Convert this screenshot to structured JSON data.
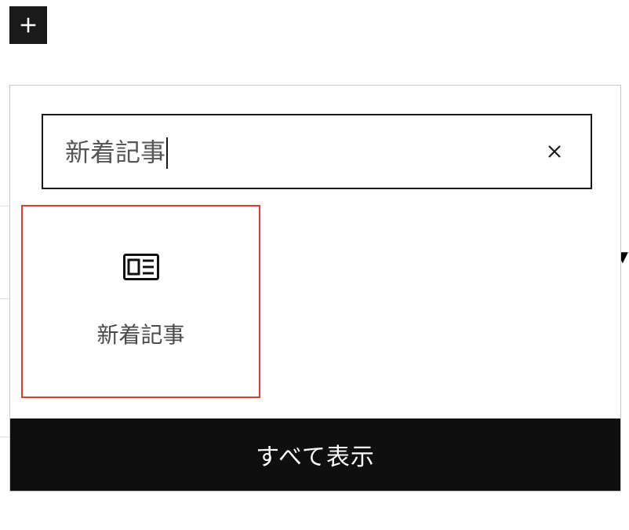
{
  "toolbar": {
    "add_button_title": "ブロックを追加"
  },
  "search": {
    "value": "新着記事",
    "clear_title": "検索をクリア"
  },
  "results": {
    "items": [
      {
        "label": "新着記事",
        "icon": "latest-posts"
      }
    ]
  },
  "footer": {
    "show_all_label": "すべて表示"
  }
}
